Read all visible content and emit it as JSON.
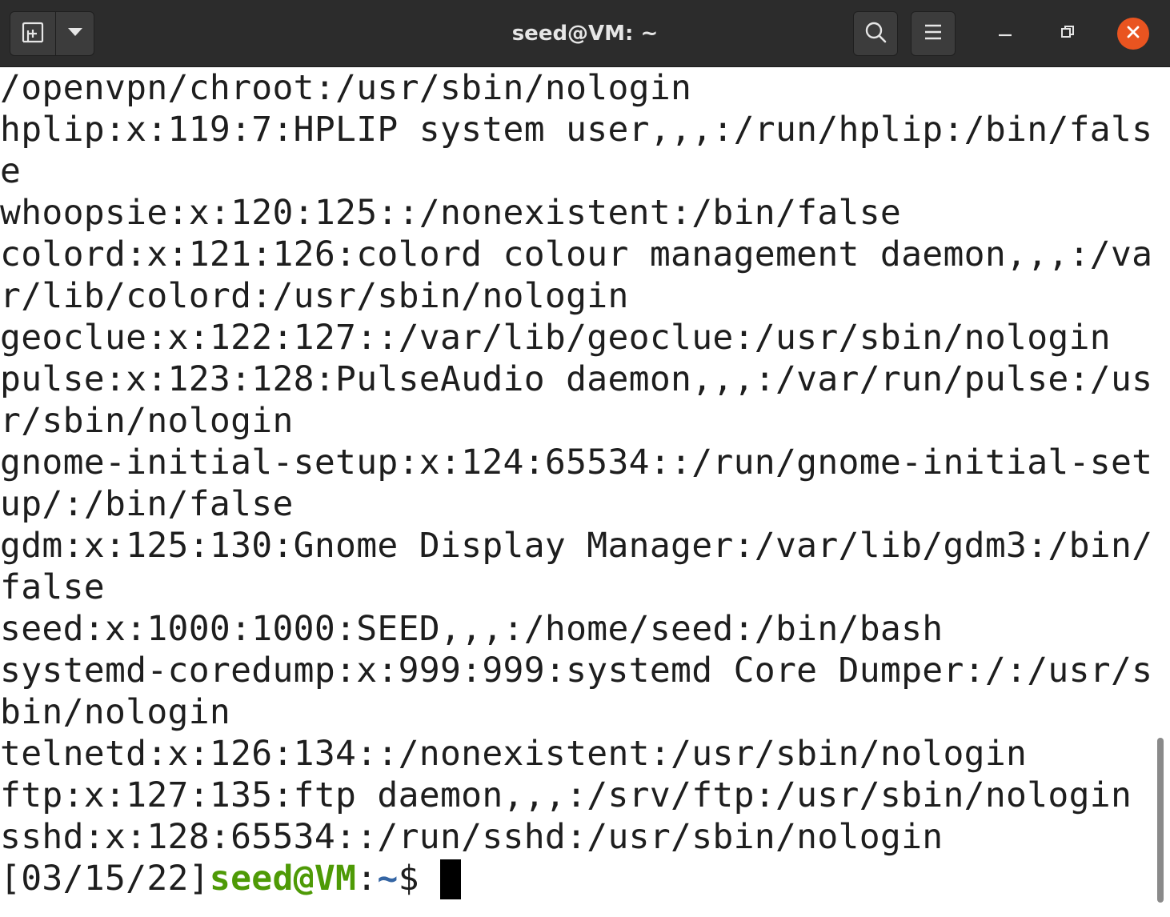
{
  "window": {
    "title": "seed@VM: ~"
  },
  "icons": {
    "new_tab": "new-tab-icon",
    "menu_dropdown": "chevron-down-icon",
    "search": "search-icon",
    "hamburger": "hamburger-menu-icon",
    "minimize": "minimize-icon",
    "restore": "restore-icon",
    "close": "close-icon"
  },
  "colors": {
    "titlebar": "#2c2c2c",
    "close_button": "#e95420",
    "prompt_user": "#4e9a06",
    "prompt_path": "#3465a4",
    "terminal_bg": "#ffffff",
    "terminal_fg": "#1e1e1e"
  },
  "terminal": {
    "lines": [
      "/openvpn/chroot:/usr/sbin/nologin",
      "hplip:x:119:7:HPLIP system user,,,:/run/hplip:/bin/fals",
      "e",
      "whoopsie:x:120:125::/nonexistent:/bin/false",
      "colord:x:121:126:colord colour management daemon,,,:/va",
      "r/lib/colord:/usr/sbin/nologin",
      "geoclue:x:122:127::/var/lib/geoclue:/usr/sbin/nologin",
      "pulse:x:123:128:PulseAudio daemon,,,:/var/run/pulse:/us",
      "r/sbin/nologin",
      "gnome-initial-setup:x:124:65534::/run/gnome-initial-set",
      "up/:/bin/false",
      "gdm:x:125:130:Gnome Display Manager:/var/lib/gdm3:/bin/",
      "false",
      "seed:x:1000:1000:SEED,,,:/home/seed:/bin/bash",
      "systemd-coredump:x:999:999:systemd Core Dumper:/:/usr/s",
      "bin/nologin",
      "telnetd:x:126:134::/nonexistent:/usr/sbin/nologin",
      "ftp:x:127:135:ftp daemon,,,:/srv/ftp:/usr/sbin/nologin",
      "sshd:x:128:65534::/run/sshd:/usr/sbin/nologin"
    ],
    "prompt": {
      "date": "[03/15/22]",
      "user_host": "seed@VM",
      "colon": ":",
      "path": "~",
      "symbol": "$ "
    }
  }
}
